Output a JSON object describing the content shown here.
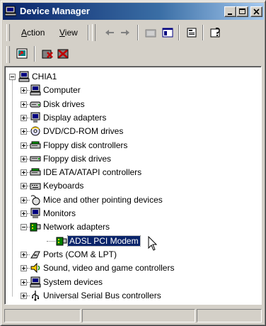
{
  "window": {
    "title": "Device Manager"
  },
  "menubar": {
    "items": [
      {
        "label": "Action",
        "mnemonic": "A",
        "rest": "ction"
      },
      {
        "label": "View",
        "mnemonic": "V",
        "rest": "iew"
      }
    ]
  },
  "toolbar": {
    "icons": [
      "back-arrow-icon",
      "forward-arrow-icon",
      "up-folder-icon",
      "show-hide-console-tree-icon",
      "properties-icon",
      "help-icon"
    ]
  },
  "toolbar2": {
    "icons": [
      "scan-hardware-icon",
      "uninstall-icon",
      "disable-icon"
    ]
  },
  "tree": {
    "root": "CHIA1",
    "items": [
      {
        "label": "Computer",
        "icon": "computer-icon",
        "expanded": false
      },
      {
        "label": "Disk drives",
        "icon": "disk-drive-icon",
        "expanded": false
      },
      {
        "label": "Display adapters",
        "icon": "display-adapter-icon",
        "expanded": false
      },
      {
        "label": "DVD/CD-ROM drives",
        "icon": "cdrom-icon",
        "expanded": false
      },
      {
        "label": "Floppy disk controllers",
        "icon": "floppy-controller-icon",
        "expanded": false
      },
      {
        "label": "Floppy disk drives",
        "icon": "floppy-drive-icon",
        "expanded": false
      },
      {
        "label": "IDE ATA/ATAPI controllers",
        "icon": "ide-controller-icon",
        "expanded": false
      },
      {
        "label": "Keyboards",
        "icon": "keyboard-icon",
        "expanded": false
      },
      {
        "label": "Mice and other pointing devices",
        "icon": "mouse-icon",
        "expanded": false
      },
      {
        "label": "Monitors",
        "icon": "monitor-icon",
        "expanded": false
      },
      {
        "label": "Network adapters",
        "icon": "network-adapter-icon",
        "expanded": true,
        "children": [
          {
            "label": "ADSL PCI Modem",
            "icon": "network-adapter-icon",
            "selected": true
          }
        ]
      },
      {
        "label": "Ports (COM & LPT)",
        "icon": "port-icon",
        "expanded": false
      },
      {
        "label": "Sound, video and game controllers",
        "icon": "sound-icon",
        "expanded": false
      },
      {
        "label": "System devices",
        "icon": "system-device-icon",
        "expanded": false
      },
      {
        "label": "Universal Serial Bus controllers",
        "icon": "usb-icon",
        "expanded": false
      }
    ]
  },
  "colors": {
    "selection": "#0a246a",
    "face": "#d4d0c8",
    "title_start": "#0a246a",
    "title_end": "#a6caf0"
  }
}
